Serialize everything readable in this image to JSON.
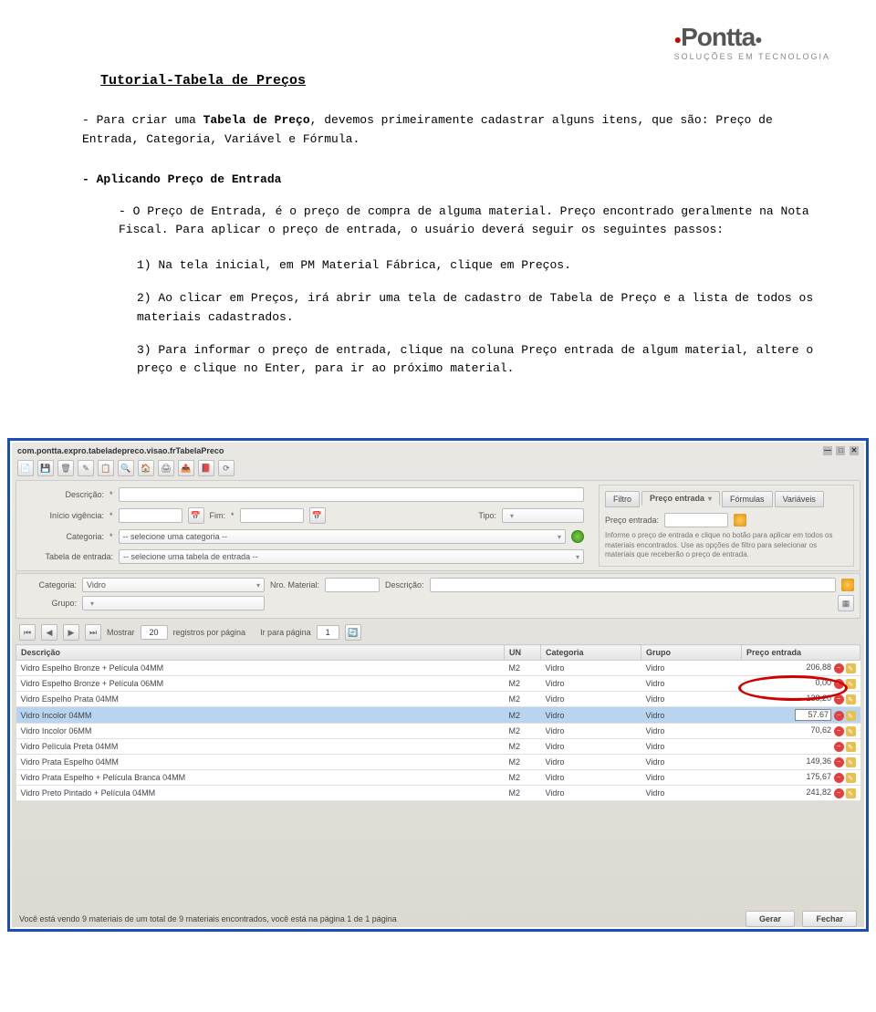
{
  "logo": {
    "text": "Pontta",
    "tagline": "SOLUÇÕES EM TECNOLOGIA"
  },
  "doc": {
    "title": "Tutorial-Tabela de Preços",
    "intro_prefix": "- Para criar uma ",
    "intro_bold": "Tabela de Preço",
    "intro_suffix": ", devemos primeiramente cadastrar alguns itens, que são: Preço de Entrada, Categoria, Variável e Fórmula.",
    "section": "- Aplicando Preço de Entrada",
    "p1": "- O Preço de Entrada, é o preço de compra de alguma material. Preço encontrado geralmente na Nota Fiscal. Para aplicar o preço de entrada, o usuário deverá seguir os seguintes passos:",
    "step1": "1) Na tela inicial, em PM Material Fábrica, clique em Preços.",
    "step2": "2) Ao clicar em Preços, irá abrir uma tela de cadastro de Tabela de Preço e a lista de todos os materiais cadastrados.",
    "step3": "3) Para informar o preço de entrada, clique na coluna Preço entrada de algum material, altere o preço e clique no Enter, para ir ao próximo material."
  },
  "app": {
    "titlebar": "com.pontta.expro.tabeladepreco.visao.frTabelaPreco",
    "labels": {
      "descricao": "Descrição:",
      "inicio": "Início vigência:",
      "fim": "Fim:",
      "tipo": "Tipo:",
      "categoria": "Categoria:",
      "tabela_entrada": "Tabela de entrada:",
      "sel_categoria": "-- selecione uma categoria --",
      "sel_tabela": "-- selecione uma tabela de entrada --",
      "nro_material": "Nro. Material:",
      "grupo": "Grupo:",
      "mostrar": "Mostrar",
      "registros": "registros por página",
      "ir_pagina": "Ir para página",
      "preco_entrada": "Preço entrada:"
    },
    "tabs": {
      "filtro": "Filtro",
      "preco_entrada": "Preço entrada",
      "formulas": "Fórmulas",
      "variaveis": "Variáveis"
    },
    "info": "Informe o preço de entrada e clique no botão para aplicar em todos os materiais encontrados. Use as opções de filtro para selecionar os materiais que receberão o preço de entrada.",
    "filter": {
      "categoria_value": "Vidro"
    },
    "pager": {
      "per_page": "20",
      "page": "1"
    },
    "cols": {
      "descricao": "Descrição",
      "un": "UN",
      "categoria": "Categoria",
      "grupo": "Grupo",
      "preco": "Preço entrada"
    },
    "rows": [
      {
        "d": "Vidro Espelho Bronze + Película 04MM",
        "un": "M2",
        "cat": "Vidro",
        "grp": "Vidro",
        "p": "206,88"
      },
      {
        "d": "Vidro Espelho Bronze + Película 06MM",
        "un": "M2",
        "cat": "Vidro",
        "grp": "Vidro",
        "p": "0,00"
      },
      {
        "d": "Vidro Espelho Prata 04MM",
        "un": "M2",
        "cat": "Vidro",
        "grp": "Vidro",
        "p": "138,20"
      },
      {
        "d": "Vidro Incolor 04MM",
        "un": "M2",
        "cat": "Vidro",
        "grp": "Vidro",
        "p": "57.67",
        "hl": true
      },
      {
        "d": "Vidro Incolor 06MM",
        "un": "M2",
        "cat": "Vidro",
        "grp": "Vidro",
        "p": "70,62"
      },
      {
        "d": "Vidro Película Preta 04MM",
        "un": "M2",
        "cat": "Vidro",
        "grp": "Vidro",
        "p": ""
      },
      {
        "d": "Vidro Prata Espelho 04MM",
        "un": "M2",
        "cat": "Vidro",
        "grp": "Vidro",
        "p": "149,36"
      },
      {
        "d": "Vidro Prata Espelho + Película Branca 04MM",
        "un": "M2",
        "cat": "Vidro",
        "grp": "Vidro",
        "p": "175,67"
      },
      {
        "d": "Vidro Preto Pintado + Película 04MM",
        "un": "M2",
        "cat": "Vidro",
        "grp": "Vidro",
        "p": "241,82"
      }
    ],
    "status": "Você está vendo 9 materiais de um total de 9 materiais encontrados, você está na página 1 de 1 página",
    "buttons": {
      "gerar": "Gerar",
      "fechar": "Fechar"
    },
    "ast": "*"
  }
}
